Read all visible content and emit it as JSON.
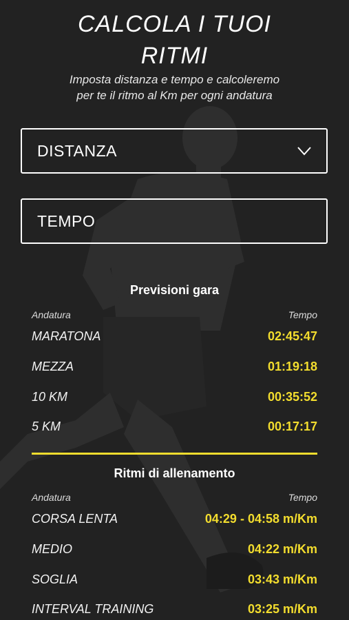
{
  "header": {
    "title_line1": "CALCOLA I TUOI",
    "title_line2": "RITMI",
    "subtitle_line1": "Imposta distanza e tempo e calcoleremo",
    "subtitle_line2": "per te il ritmo al Km per ogni andatura"
  },
  "form": {
    "distance_label": "DISTANZA",
    "time_label": "TEMPO"
  },
  "race_predictions": {
    "title": "Previsioni gara",
    "col_left": "Andatura",
    "col_right": "Tempo",
    "rows": [
      {
        "label": "MARATONA",
        "value": "02:45:47"
      },
      {
        "label": "MEZZA",
        "value": "01:19:18"
      },
      {
        "label": "10 KM",
        "value": "00:35:52"
      },
      {
        "label": "5 KM",
        "value": "00:17:17"
      }
    ]
  },
  "training_paces": {
    "title": "Ritmi di allenamento",
    "col_left": "Andatura",
    "col_right": "Tempo",
    "rows": [
      {
        "label": "CORSA LENTA",
        "value": "04:29 - 04:58 m/Km"
      },
      {
        "label": "MEDIO",
        "value": "04:22 m/Km"
      },
      {
        "label": "SOGLIA",
        "value": "03:43 m/Km"
      },
      {
        "label": "INTERVAL TRAINING",
        "value": "03:25 m/Km"
      }
    ]
  },
  "colors": {
    "background": "#222222",
    "accent": "#f3dd2e",
    "text": "#ffffff"
  },
  "icons": {
    "dropdown": "chevron-down-icon",
    "background_image": "runner-silhouette"
  }
}
